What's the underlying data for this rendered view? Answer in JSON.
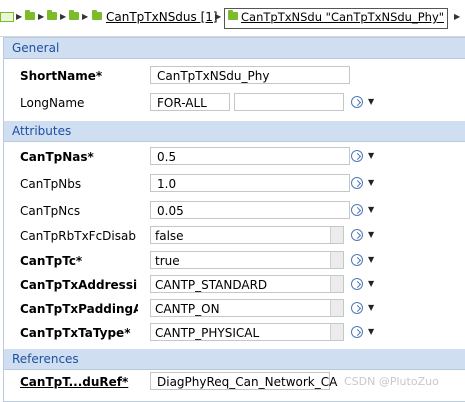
{
  "breadcrumb": {
    "items": [
      "CanTpTxNSdus [1]",
      "CanTpTxNSdu \"CanTpTxNSdu_Phy\""
    ],
    "arrow": "▶",
    "end_arrow": "▶"
  },
  "sections": {
    "general": "General",
    "attributes": "Attributes",
    "references": "References"
  },
  "general": {
    "shortname_label": "ShortName*",
    "shortname_value": "CanTpTxNSdu_Phy",
    "longname_label": "LongName",
    "longname_lang": "FOR-ALL",
    "longname_value": ""
  },
  "attributes": [
    {
      "label": "CanTpNas*",
      "value": "0.5",
      "bold": true,
      "kind": "text"
    },
    {
      "label": "CanTpNbs",
      "value": "1.0",
      "bold": false,
      "kind": "text"
    },
    {
      "label": "CanTpNcs",
      "value": "0.05",
      "bold": false,
      "kind": "text"
    },
    {
      "label": "CanTpRbTxFcDisab",
      "value": "false",
      "bold": false,
      "kind": "combo"
    },
    {
      "label": "CanTpTc*",
      "value": "true",
      "bold": true,
      "kind": "combo"
    },
    {
      "label": "CanTpTxAddressir",
      "value": "CANTP_STANDARD",
      "bold": true,
      "kind": "combo"
    },
    {
      "label": "CanTpTxPaddingA",
      "value": "CANTP_ON",
      "bold": true,
      "kind": "combo"
    },
    {
      "label": "CanTpTxTaType*",
      "value": "CANTP_PHYSICAL",
      "bold": true,
      "kind": "combo"
    }
  ],
  "references": {
    "label": "CanTpT...duRef*",
    "value": "DiagPhyReq_Can_Network_CA"
  },
  "dropdown_arrow": "▼",
  "watermark": "CSDN @PlutoZuo",
  "colors": {
    "section_bg": "#cfdff1",
    "section_text": "#1f4fa0",
    "folder": "#7cbb2a"
  }
}
